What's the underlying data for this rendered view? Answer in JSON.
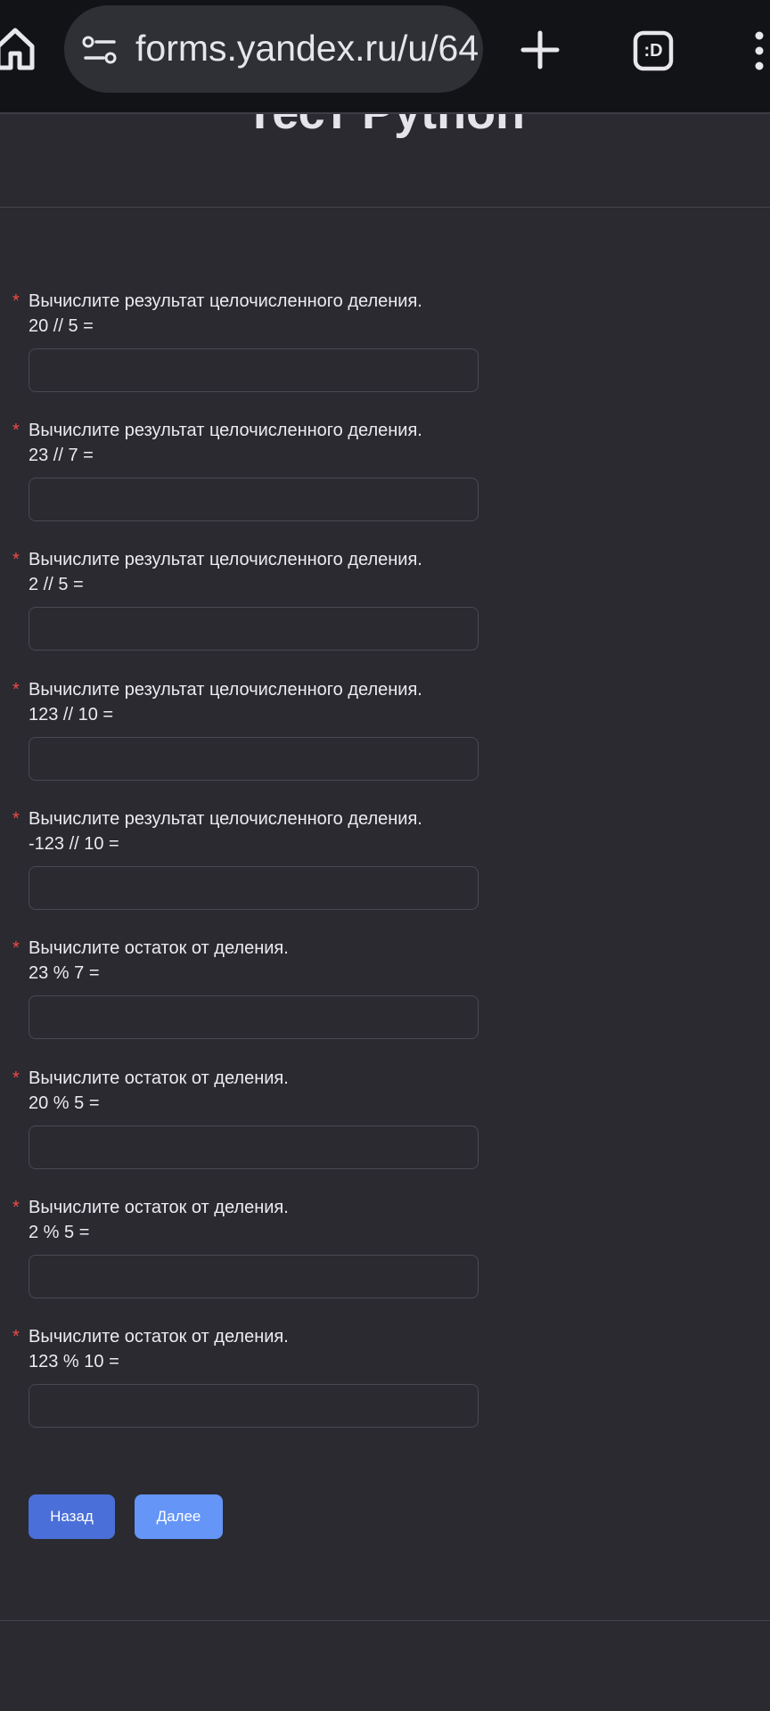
{
  "browser": {
    "url": "forms.yandex.ru/u/64",
    "tabs_label": ":D"
  },
  "form": {
    "title": "Тест Python",
    "questions": [
      {
        "label": "Вычислите результат целочисленного деления.\n20 // 5 =",
        "value": ""
      },
      {
        "label": "Вычислите результат целочисленного деления.\n23 // 7 =",
        "value": ""
      },
      {
        "label": "Вычислите результат целочисленного деления.\n2 // 5 =",
        "value": ""
      },
      {
        "label": "Вычислите результат целочисленного деления.\n123 // 10 =",
        "value": ""
      },
      {
        "label": "Вычислите результат целочисленного деления.\n-123 // 10 =",
        "value": ""
      },
      {
        "label": "Вычислите остаток от деления.\n23 % 7 =",
        "value": ""
      },
      {
        "label": "Вычислите остаток от деления.\n20 % 5 =",
        "value": ""
      },
      {
        "label": "Вычислите остаток от деления.\n2 % 5 =",
        "value": ""
      },
      {
        "label": "Вычислите остаток от деления.\n123 % 10 =",
        "value": ""
      }
    ],
    "required_mark": "*",
    "back_label": "Назад",
    "next_label": "Далее"
  },
  "colors": {
    "background": "#2b2a31",
    "required": "#f04b45",
    "back_button": "#4a6fd8",
    "next_button": "#6495f7"
  }
}
